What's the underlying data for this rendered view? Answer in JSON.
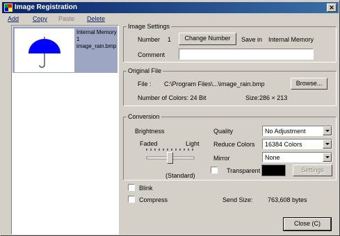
{
  "window": {
    "title": "Image Registration",
    "close_glyph": "✕"
  },
  "menu": {
    "add": "Add",
    "copy": "Copy",
    "paste": "Paste",
    "delete": "Delete"
  },
  "list": {
    "items": [
      {
        "line1": "Internal Memory",
        "line2": "1",
        "line3": "image_rain.bmp",
        "icon": "umbrella-icon"
      }
    ]
  },
  "image_settings": {
    "legend": "Image Settings",
    "number_label": "Number",
    "number_value": "1",
    "change_number": "Change Number",
    "save_in_label": "Save in",
    "save_in_value": "Internal Memory",
    "comment_label": "Comment",
    "comment_value": ""
  },
  "original_file": {
    "legend": "Original File",
    "file_label": "File :",
    "file_path": "C:\\Program  Files\\...\\image_rain.bmp",
    "browse": "Browse...",
    "colors_text": "Number of Colors: 24 Bit",
    "size_label": "Size:",
    "size_value": "286  ×  213"
  },
  "conversion": {
    "legend": "Conversion",
    "brightness": "Brightness",
    "faded": "Faded",
    "light": "Light",
    "standard": "(Standard)",
    "quality_label": "Quality",
    "quality_value": "No Adjustment",
    "reduce_label": "Reduce Colors",
    "reduce_value": "16384 Colors",
    "mirror_label": "Mirror",
    "mirror_value": "None",
    "transparent_label": "Transparent",
    "transparent_color": "#000000",
    "settings": "Settings"
  },
  "blink_label": "Blink",
  "compress_label": "Compress",
  "send_size_label": "Send Size:",
  "send_size_value": "763,608 bytes",
  "close_button": "Close (C)",
  "colors": {
    "title_start": "#0a246a",
    "title_end": "#3a6ea5",
    "selection": "#9da7c4",
    "umbrella": "#0000ff"
  }
}
